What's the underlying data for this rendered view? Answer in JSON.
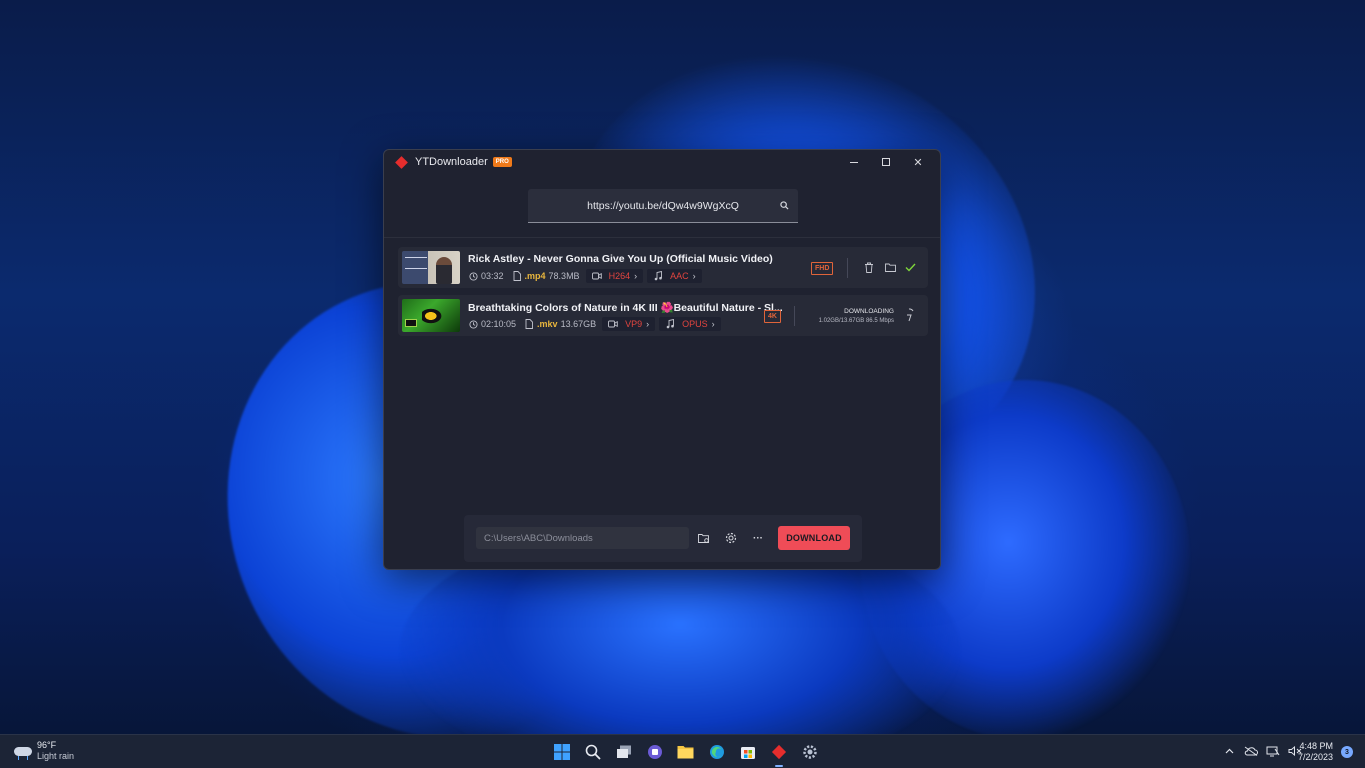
{
  "window": {
    "app_name": "YTDownloader",
    "badge": "PRO",
    "controls": {
      "minimize": "minimize",
      "maximize": "maximize",
      "close": "✕"
    }
  },
  "search": {
    "url": "https://youtu.be/dQw4w9WgXcQ"
  },
  "items": [
    {
      "title": "Rick Astley - Never Gonna Give You Up (Official Music Video)",
      "duration": "03:32",
      "ext": ".mp4",
      "size": "78.3MB",
      "video_codec": "H264",
      "audio_codec": "AAC",
      "quality": "FHD",
      "status": "complete"
    },
    {
      "title": "Breathtaking Colors of Nature in 4K III 🌺Beautiful Nature - Sl...",
      "duration": "02:10:05",
      "ext": ".mkv",
      "size": "13.67GB",
      "video_codec": "VP9",
      "audio_codec": "OPUS",
      "quality": "4K",
      "status": "DOWNLOADING",
      "progress_text": "1.02GB/13.67GB 86.5 Mbps",
      "progress_fraction": 0.075
    }
  ],
  "bottom": {
    "path": "C:\\Users\\ABC\\Downloads",
    "download_label": "DOWNLOAD",
    "more_label": "···"
  },
  "taskbar": {
    "weather_temp": "96°F",
    "weather_desc": "Light rain",
    "time": "4:48 PM",
    "date": "7/2/2023",
    "notification_count": "3",
    "apps": [
      "start-icon",
      "search-icon",
      "task-view-icon",
      "teams-icon",
      "file-explorer-icon",
      "edge-icon",
      "store-icon",
      "ytdownloader-icon",
      "settings-icon"
    ]
  },
  "colors": {
    "accent": "#ef4c57",
    "quality_border": "#e0643a",
    "codec": "#e1453f",
    "ext": "#e9b63d",
    "check": "#7fd63a"
  }
}
